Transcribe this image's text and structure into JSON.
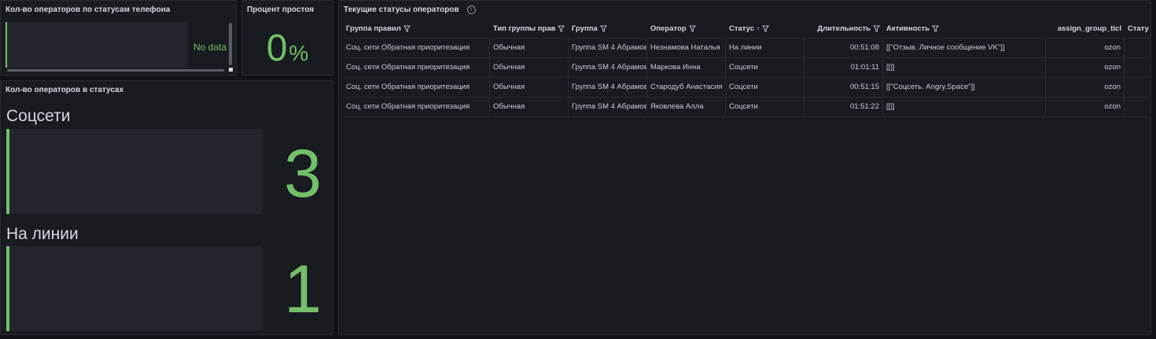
{
  "phone_panel": {
    "title": "Кол-во операторов по статусам телефона",
    "no_data": "No data"
  },
  "idle_panel": {
    "title": "Процент простоя",
    "value": "0",
    "unit": "%"
  },
  "status_panel": {
    "title": "Кол-во операторов в статусах",
    "items": [
      {
        "label": "Соцсети",
        "value": "3"
      },
      {
        "label": "На линии",
        "value": "1"
      }
    ]
  },
  "table_panel": {
    "title": "Текущие статусы операторов",
    "info_icon": "i",
    "sort_icon": "↑",
    "columns": [
      "Группа правил",
      "Тип группы прав",
      "Группа",
      "Оператор",
      "Статус",
      "Длительность",
      "Активность",
      "assign_group_ticl",
      "Стату"
    ],
    "rows": [
      [
        "Соц. сети Обратная приоритезация",
        "Обычная",
        "Группа SM 4 Абрамов",
        "Незнамова Наталья",
        "На линии",
        "00:51:08",
        "[[\"Отзыв. Личное сообщение VK\"]]",
        "ozon",
        ""
      ],
      [
        "Соц. сети Обратная приоритезация",
        "Обычная",
        "Группа SM 4 Абрамов",
        "Маркова Инна",
        "Соцсети",
        "01:01:11",
        "[[]]",
        "ozon",
        ""
      ],
      [
        "Соц. сети Обратная приоритезация",
        "Обычная",
        "Группа SM 4 Абрамов",
        "Стародуб Анастасия",
        "Соцсети",
        "00:51:15",
        "[[\"Соцсеть. Angry.Space\"]]",
        "ozon",
        ""
      ],
      [
        "Соц. сети Обратная приоритезация",
        "Обычная",
        "Группа SM 4 Абрамов",
        "Яковлева Алла",
        "Соцсети",
        "01:51:22",
        "[[]]",
        "ozon",
        ""
      ]
    ]
  },
  "colors": {
    "accent_green": "#73bf69",
    "panel_bg": "#181b1f",
    "page_bg": "#111217"
  }
}
